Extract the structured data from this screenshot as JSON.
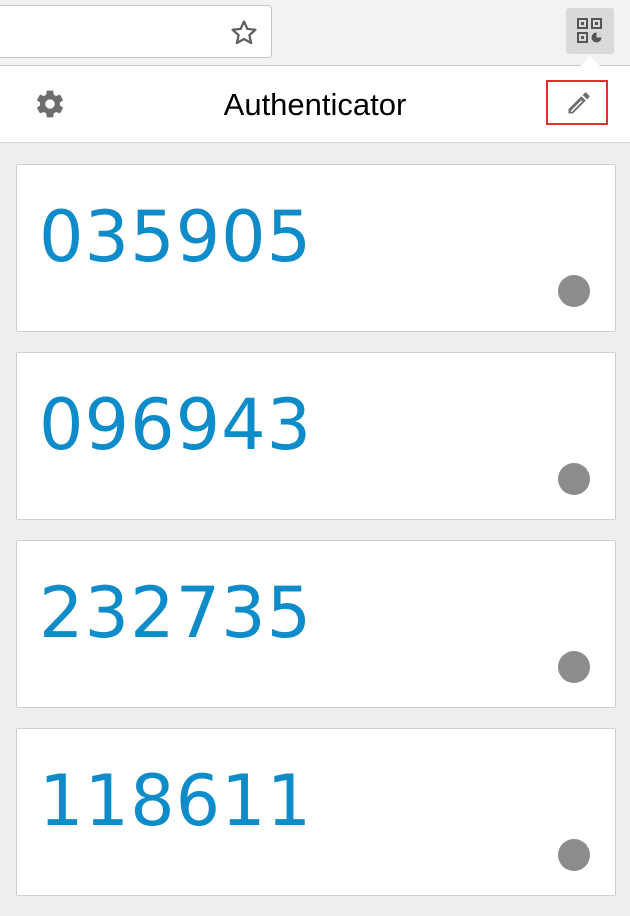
{
  "browser": {
    "bookmark_icon": "star-icon",
    "extension_icon": "qr-code-icon"
  },
  "header": {
    "title": "Authenticator",
    "settings_icon": "gear-icon",
    "edit_icon": "pencil-icon",
    "edit_highlight_color": "#e0302a"
  },
  "codes": [
    {
      "code": "035905"
    },
    {
      "code": "096943"
    },
    {
      "code": "232735"
    },
    {
      "code": "118611"
    }
  ],
  "colors": {
    "code_text": "#0e8bc9",
    "timer": "#8c8c8c",
    "background": "#eeeeee"
  }
}
